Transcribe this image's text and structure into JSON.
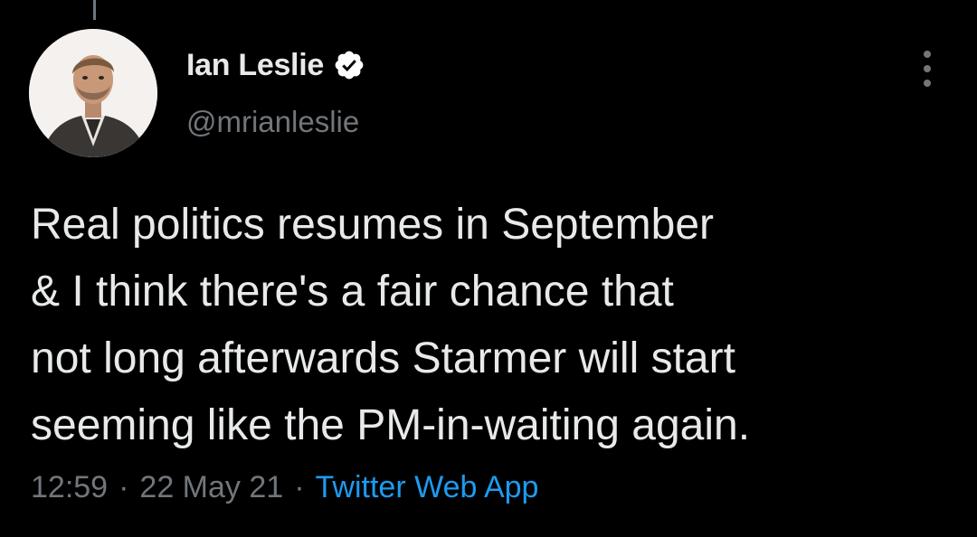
{
  "tweet": {
    "author": {
      "display_name": "Ian Leslie",
      "handle": "@mrianleslie",
      "verified": true,
      "avatar_icon": "profile-photo"
    },
    "more_icon": "more-options-icon",
    "text": "Real politics resumes in September\n& I think there's a fair chance that\nnot long afterwards Starmer will start\nseeming like the PM-in-waiting again.",
    "time": "12:59",
    "separator": "·",
    "date": "22 May 21",
    "source": "Twitter Web App"
  },
  "colors": {
    "background": "#000000",
    "text_primary": "#e7e9ea",
    "text_secondary": "#71767b",
    "link": "#1d9bf0",
    "verified_badge": "#ffffff"
  }
}
